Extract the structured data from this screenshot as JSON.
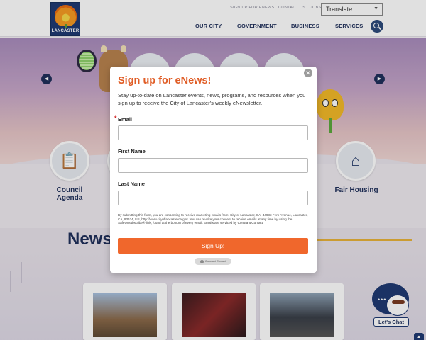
{
  "header": {
    "logo_text": "LANCASTER",
    "utility_links": [
      "SIGN UP FOR ENEWS",
      "CONTACT US",
      "JOBS"
    ],
    "translate_label": "Translate",
    "nav": [
      "OUR CITY",
      "GOVERNMENT",
      "BUSINESS",
      "SERVICES"
    ]
  },
  "quick_links": [
    {
      "label": "Council Agenda",
      "icon": "clipboard-icon"
    },
    {
      "label": "Fair Housing",
      "icon": "house-icon"
    }
  ],
  "news": {
    "heading": "News"
  },
  "chat": {
    "label": "Let's Chat"
  },
  "modal": {
    "title": "Sign up for eNews!",
    "description": "Stay up-to-date on Lancaster events, news, programs, and resources when you sign up to receive the City of Lancaster's weekly eNewsletter.",
    "required_marker": "*",
    "fields": {
      "email_label": "Email",
      "first_name_label": "First Name",
      "last_name_label": "Last Name"
    },
    "legal_text": "By submitting this form, you are consenting to receive marketing emails from: City of Lancaster, CA, 44933 Fern Avenue, Lancaster, CA, 93534, US, http://www.cityoflancasterca.gov. You can revoke your consent to receive emails at any time by using the SafeUnsubscribe® link, found at the bottom of every email.",
    "legal_link": "Emails are serviced by Constant Contact.",
    "submit_label": "Sign Up!",
    "badge_text": "Constant Contact"
  },
  "colors": {
    "brand_navy": "#1f2f5a",
    "accent_orange": "#f0672c",
    "title_orange": "#e05d26"
  }
}
